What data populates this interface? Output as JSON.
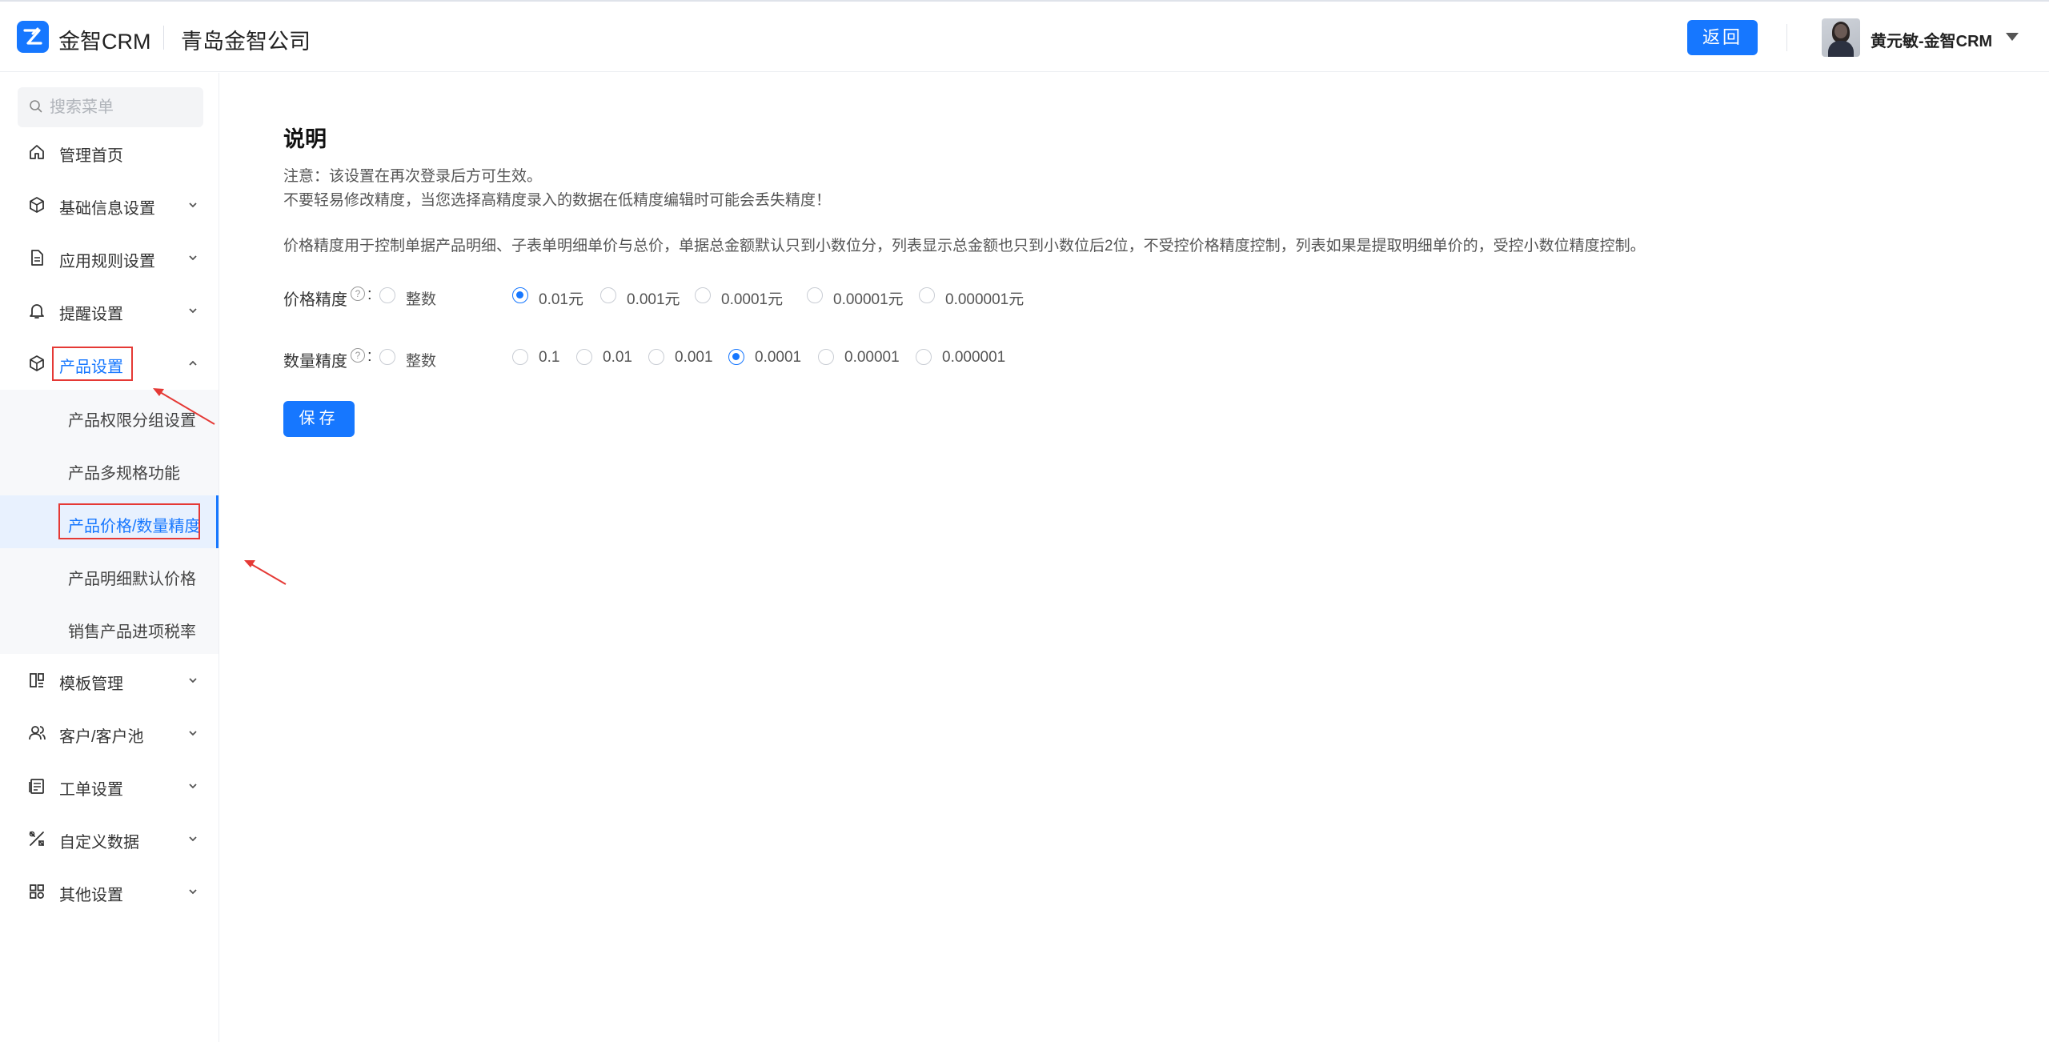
{
  "header": {
    "brand": "金智CRM",
    "company": "青岛金智公司",
    "return_label": "返回",
    "username": "黄元敏-金智CRM"
  },
  "sidebar": {
    "search_placeholder": "搜索菜单",
    "items": [
      {
        "label": "管理首页",
        "icon": "home-icon"
      },
      {
        "label": "基础信息设置",
        "icon": "cube-icon"
      },
      {
        "label": "应用规则设置",
        "icon": "document-icon"
      },
      {
        "label": "提醒设置",
        "icon": "bell-icon"
      },
      {
        "label": "产品设置",
        "icon": "box-icon",
        "expanded": true
      },
      {
        "label": "模板管理",
        "icon": "template-icon"
      },
      {
        "label": "客户/客户池",
        "icon": "customer-icon"
      },
      {
        "label": "工单设置",
        "icon": "workorder-icon"
      },
      {
        "label": "自定义数据",
        "icon": "tools-icon"
      },
      {
        "label": "其他设置",
        "icon": "apps-icon"
      }
    ],
    "subitems": [
      {
        "label": "产品权限分组设置"
      },
      {
        "label": "产品多规格功能"
      },
      {
        "label": "产品价格/数量精度",
        "selected": true
      },
      {
        "label": "产品明细默认价格"
      },
      {
        "label": "销售产品进项税率"
      }
    ]
  },
  "main": {
    "title": "说明",
    "note1": "注意：该设置在再次登录后方可生效。",
    "note2": "不要轻易修改精度，当您选择高精度录入的数据在低精度编辑时可能会丢失精度！",
    "note3": "价格精度用于控制单据产品明细、子表单明细单价与总价，单据总金额默认只到小数位分，列表显示总金额也只到小数位后2位，不受控价格精度控制，列表如果是提取明细单价的，受控小数位精度控制。",
    "price_label": "价格精度",
    "price_options": [
      "整数",
      "0.01元",
      "0.001元",
      "0.0001元",
      "0.00001元",
      "0.000001元"
    ],
    "price_selected": "0.01元",
    "qty_label": "数量精度",
    "qty_options": [
      "整数",
      "0.1",
      "0.01",
      "0.001",
      "0.0001",
      "0.00001",
      "0.000001"
    ],
    "qty_selected": "0.0001",
    "help_glyph": "?",
    "colon": ":",
    "save_label": "保存"
  },
  "colors": {
    "accent": "#1677ff",
    "annotation": "#e53935"
  }
}
